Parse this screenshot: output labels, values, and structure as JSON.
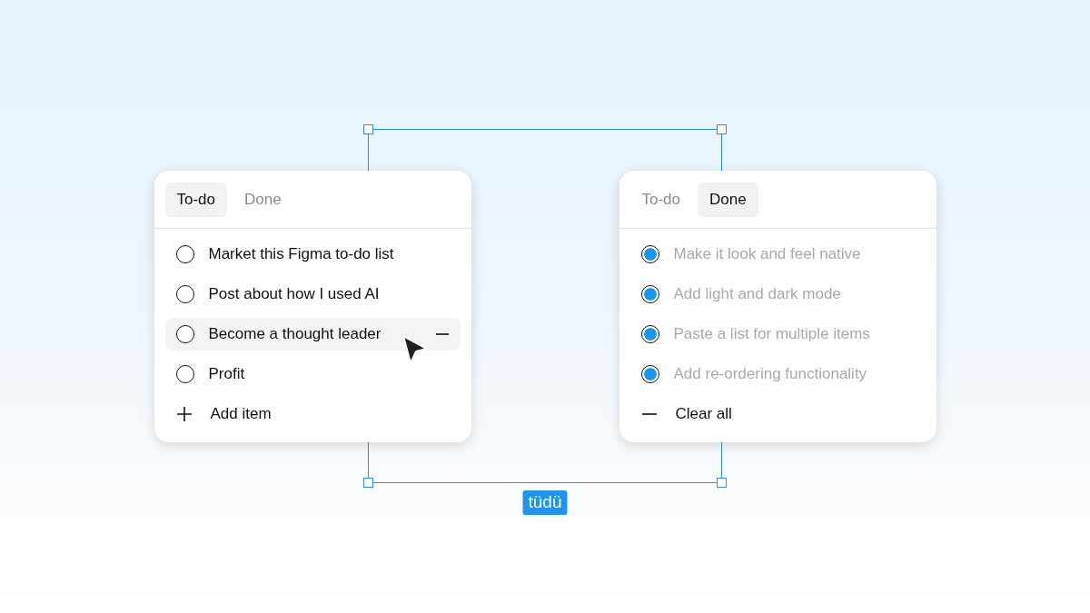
{
  "panels": [
    {
      "tabs": [
        {
          "label": "To-do",
          "selected": true
        },
        {
          "label": "Done",
          "selected": false
        }
      ],
      "items": [
        {
          "text": "Market this Figma to-do list",
          "checked": false,
          "hovered": false
        },
        {
          "text": "Post about how I used AI",
          "checked": false,
          "hovered": false
        },
        {
          "text": "Become a thought leader",
          "checked": false,
          "hovered": true
        },
        {
          "text": "Profit",
          "checked": false,
          "hovered": false
        }
      ],
      "action": {
        "kind": "add",
        "label": "Add item"
      }
    },
    {
      "tabs": [
        {
          "label": "To-do",
          "selected": false
        },
        {
          "label": "Done",
          "selected": true
        }
      ],
      "items": [
        {
          "text": "Make it look and feel native",
          "checked": true,
          "hovered": false
        },
        {
          "text": "Add light and dark mode",
          "checked": true,
          "hovered": false
        },
        {
          "text": "Paste a list for multiple items",
          "checked": true,
          "hovered": false
        },
        {
          "text": "Add re-ordering functionality",
          "checked": true,
          "hovered": false
        }
      ],
      "action": {
        "kind": "clear",
        "label": "Clear all"
      }
    }
  ],
  "frame_label": "tüdü"
}
